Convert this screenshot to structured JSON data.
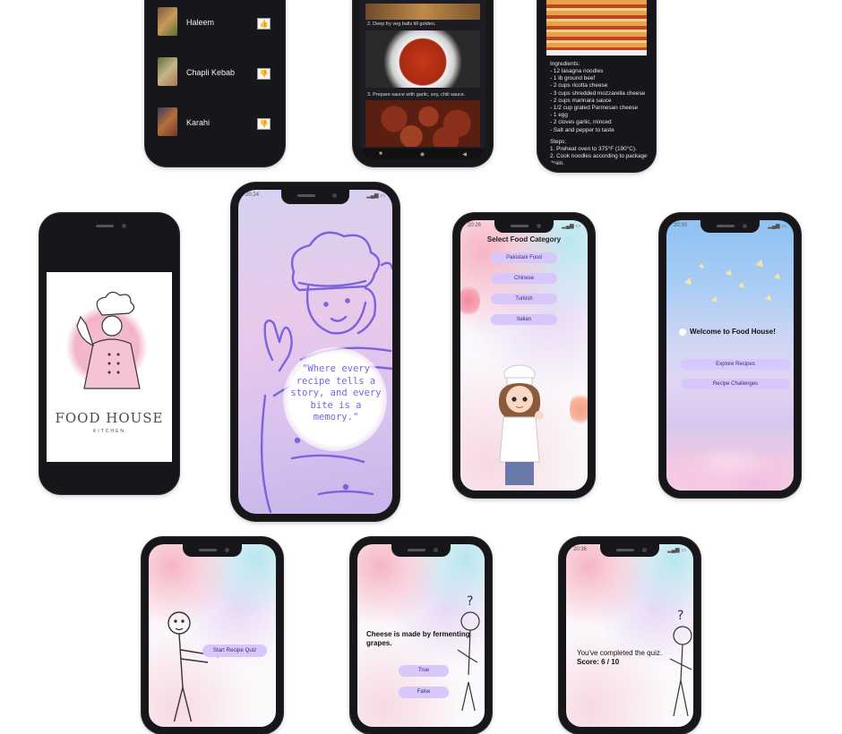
{
  "phone_list": {
    "items": [
      {
        "name": "Haleem",
        "icon": "thumbs-up-icon"
      },
      {
        "name": "Chapli Kebab",
        "icon": "thumbs-down-icon"
      },
      {
        "name": "Karahi",
        "icon": "thumbs-down-icon"
      }
    ]
  },
  "phone_steps": {
    "step2": "2. Deep fry veg balls till golden.",
    "step3": "3. Prepare sauce with garlic, soy, chili sauce."
  },
  "phone_lasagna": {
    "ingredients_title": "Ingredients:",
    "ingredients": [
      "- 12 lasagna noodles",
      "- 1 lb ground beef",
      "- 2 cups ricotta cheese",
      "- 3 cups shredded mozzarella cheese",
      "- 2 cups marinara sauce",
      "- 1/2 cup grated Parmesan cheese",
      "- 1 egg",
      "- 2 cloves garlic, minced",
      "- Salt and pepper to taste"
    ],
    "steps_title": "Steps:",
    "steps": [
      "1. Preheat oven to 375°F (190°C).",
      "2. Cook noodles according to package",
      "drain."
    ]
  },
  "phone_logo": {
    "brand": "FOOD HOUSE",
    "sub": "KITCHEN"
  },
  "phone_quote": {
    "time": "20:24",
    "quote": "\"Where every recipe tells a story, and every bite is a memory.\""
  },
  "phone_category": {
    "time": "20:26",
    "title": "Select Food Category",
    "buttons": [
      "Pakistani Food",
      "Chinese",
      "Turkish",
      "Italian"
    ]
  },
  "phone_welcome": {
    "time": "20:30",
    "title": "Welcome to Food House!",
    "buttons": [
      "Explore Recipes",
      "Recipe Challenges"
    ]
  },
  "phone_quiz_start": {
    "button": "Start Recipe Quiz"
  },
  "phone_question": {
    "question": "Cheese is made by fermenting grapes.",
    "true_label": "True",
    "false_label": "False"
  },
  "phone_result": {
    "time": "20:36",
    "line1": "You've completed the quiz.",
    "line2": "Score: 6 / 10"
  },
  "colors": {
    "phone_frame": "#17171b",
    "button_lavender": "#d8c7fb",
    "dark_screen": "#16161b",
    "quote_purple": "#7b63e0"
  }
}
